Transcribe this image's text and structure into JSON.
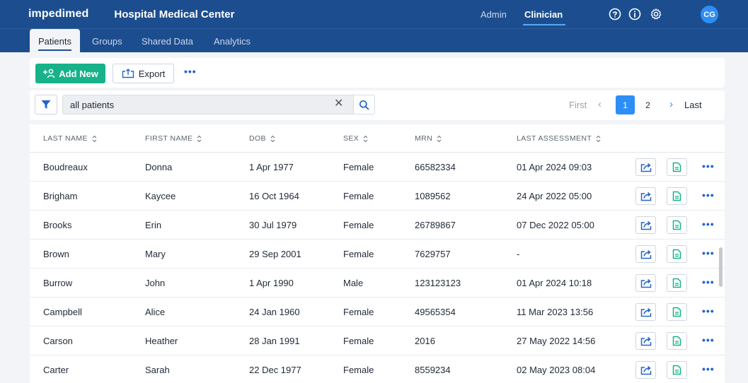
{
  "app": {
    "brand": "impedimed",
    "organization": "Hospital Medical Center",
    "roles": [
      "Admin",
      "Clinician"
    ],
    "active_role": "Clinician",
    "user_initials": "CG",
    "brand_color": "#1c4e8f",
    "accent_color": "#2d8ef5"
  },
  "header_icons": [
    "help-icon",
    "info-icon",
    "settings-gear-icon"
  ],
  "tabs": [
    "Patients",
    "Groups",
    "Shared Data",
    "Analytics"
  ],
  "toolbar": {
    "add_label": "Add New",
    "export_label": "Export",
    "more_label": "•••",
    "add_color": "#17b28a"
  },
  "filter": {
    "search_value": "all patients",
    "clear_label": "✕"
  },
  "pagination": {
    "first_label": "First",
    "last_label": "Last",
    "prev_label": "‹",
    "next_label": "›",
    "pages": [
      "1",
      "2"
    ],
    "current_page": "1"
  },
  "table": {
    "columns": [
      "LAST NAME",
      "FIRST NAME",
      "DOB",
      "SEX",
      "MRN",
      "LAST ASSESSMENT"
    ],
    "rows": [
      [
        "Boudreaux",
        "Donna",
        "1 Apr 1977",
        "Female",
        "66582334",
        "01 Apr 2024 09:03"
      ],
      [
        "Brigham",
        "Kaycee",
        "16 Oct 1964",
        "Female",
        "1089562",
        "24 Apr 2022 05:00"
      ],
      [
        "Brooks",
        "Erin",
        "30 Jul 1979",
        "Female",
        "26789867",
        "07 Dec 2022 05:00"
      ],
      [
        "Brown",
        "Mary",
        "29 Sep 2001",
        "Female",
        "7629757",
        "-"
      ],
      [
        "Burrow",
        "John",
        "1 Apr 1990",
        "Male",
        "123123123",
        "01 Apr 2024 10:18"
      ],
      [
        "Campbell",
        "Alice",
        "24 Jan 1960",
        "Female",
        "49565354",
        "11 Mar 2023 13:56"
      ],
      [
        "Carson",
        "Heather",
        "28 Jan 1991",
        "Female",
        "2016",
        "27 May 2022 14:56"
      ],
      [
        "Carter",
        "Sarah",
        "22 Dec 1977",
        "Female",
        "8559234",
        "02 May 2023 08:04"
      ]
    ],
    "row_action_icons": [
      "share-export-icon",
      "report-document-icon"
    ],
    "row_more_label": "•••"
  }
}
